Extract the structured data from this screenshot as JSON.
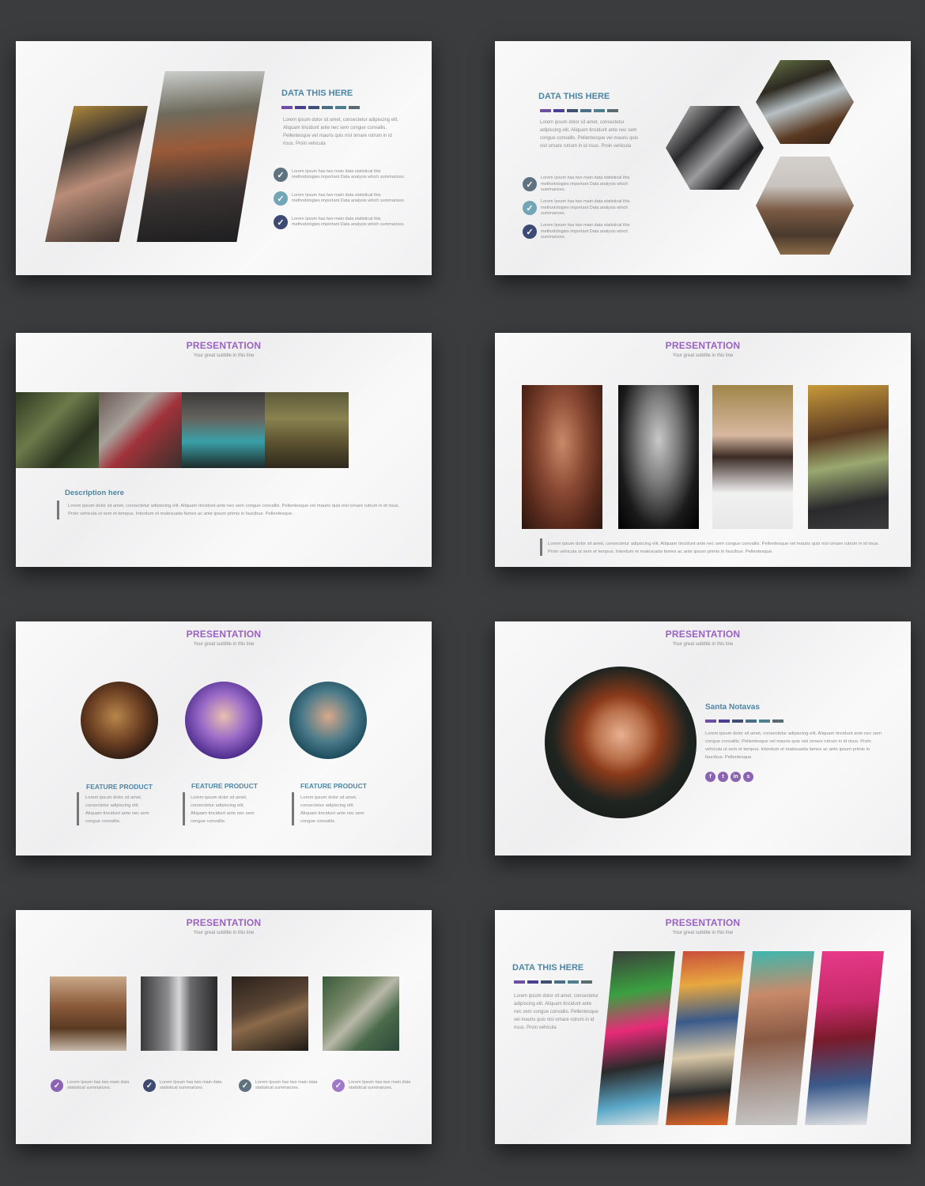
{
  "colors": {
    "purple": "#9a62c0",
    "teal": "#4d86a4",
    "bar_palette": [
      "#6e4ea3",
      "#4b3f92",
      "#3f4e73",
      "#4a6f84",
      "#4d7f8e",
      "#5a6b6f"
    ],
    "check_palette": [
      "#5f7280",
      "#72a5b6",
      "#3d4a72"
    ]
  },
  "lorem_check": "Lorem Ipsum has two main data statistical this methodologies important Data analysis which summarizes.",
  "lorem_check_short": "Lorem Ipsum has two main data statistical summarizes.",
  "lorem_intro": "Lorem ipsum dolor sit amet, consectetur adipiscing elit. Aliquam tincidunt ante nec sem congue convallis. Pellentesque vel mauris quis nisl ornare rutrum in id risus. Proin vehicula",
  "lorem_long": "Lorem ipsum dolor sit amet, consectetur adipiscing elit. Aliquam tincidunt ante nec sem congue convallis. Pellentesque vel mauris quis nisl ornare rutrum in id risus. Proin vehicula ut sem et tempus. Interdum et malesuada fames ac ante ipsum primis in faucibus. Pellentesque.",
  "lorem_feature": "Lorem ipsum dolor sit amet, consectetur adipiscing elit. Aliquam tincidunt ante nec sem congue convallis.",
  "slides": {
    "s1": {
      "heading": "DATA THIS  HERE"
    },
    "s2": {
      "heading": "DATA THIS  HERE"
    },
    "s3": {
      "title": "PRESENTATION",
      "subtitle": "Your great subtitle in this line",
      "desc_heading": "Description here"
    },
    "s4": {
      "title": "PRESENTATION",
      "subtitle": "Your great subtitle in this line"
    },
    "s5": {
      "title": "PRESENTATION",
      "subtitle": "Your great subtitle in this line",
      "features": [
        "FEATURE PRODUCT",
        "FEATURE PRODUCT",
        "FEATURE PRODUCT"
      ]
    },
    "s6": {
      "title": "PRESENTATION",
      "subtitle": "Your great subtitle in this line",
      "name": "Santa Notavas",
      "social": [
        "f",
        "t",
        "in",
        "s"
      ]
    },
    "s7": {
      "title": "PRESENTATION",
      "subtitle": "Your great subtitle in this line"
    },
    "s8": {
      "title": "PRESENTATION",
      "subtitle": "Your great subtitle in this line",
      "heading": "DATA THIS  HERE",
      "intro": "Lorem ipsum dolor sit amet, consectetur adipiscing elit. Aliquam tincidunt ante nec sem congue convallis. Pellentesque vel mauris quis nisl ornare rutrum in id risus. Proin vehicula"
    }
  }
}
